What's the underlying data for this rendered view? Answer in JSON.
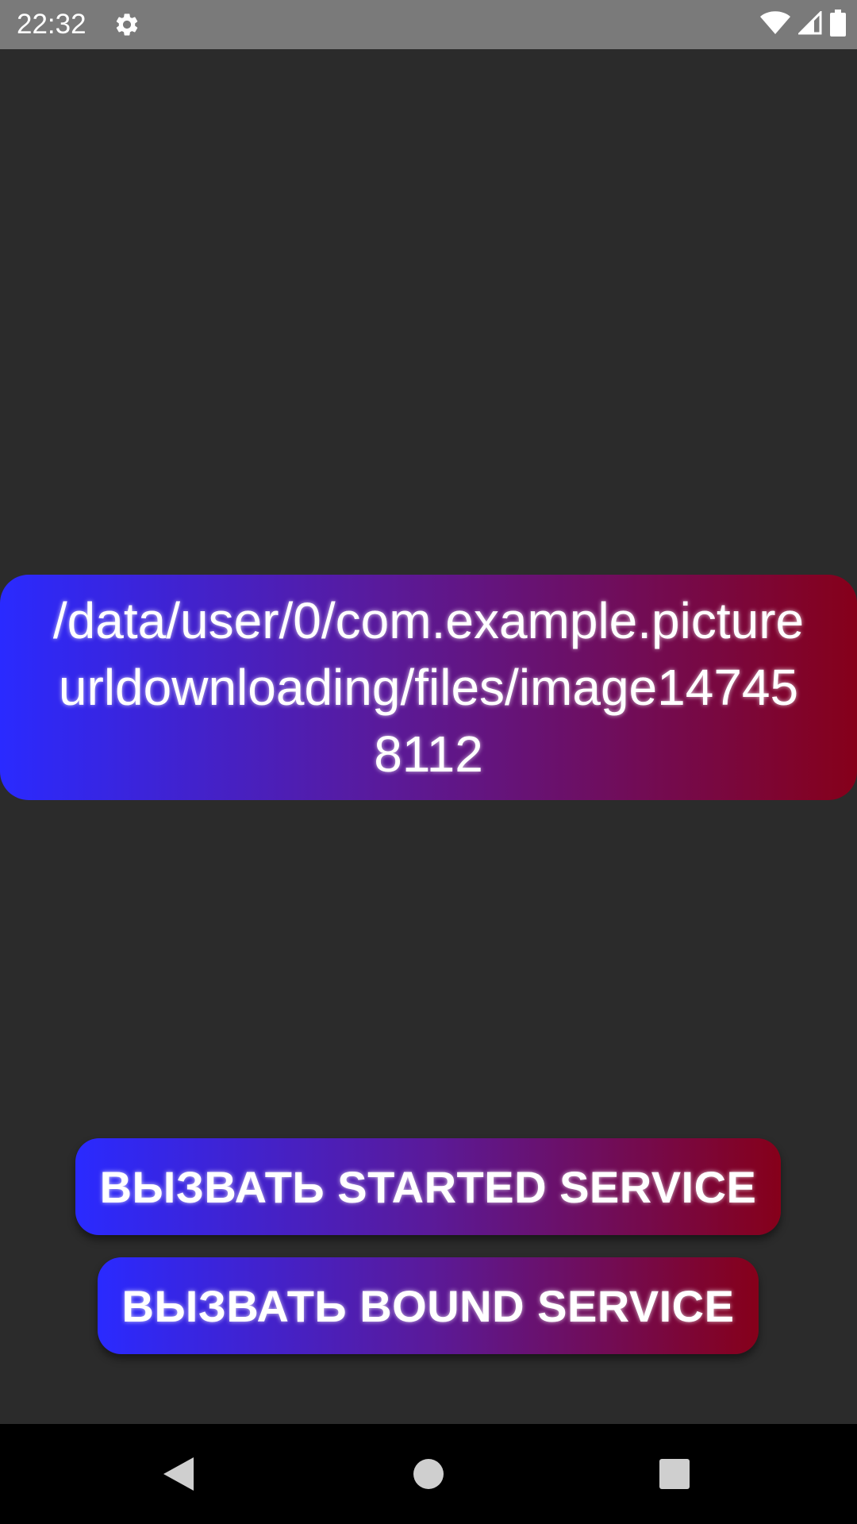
{
  "status_bar": {
    "time": "22:32",
    "icons": [
      "gear-icon",
      "wifi-icon",
      "cell-signal-icon",
      "battery-icon"
    ]
  },
  "main": {
    "file_path": "/data/user/0/com.example.pictureurldownloading/files/image147458112"
  },
  "buttons": {
    "started_service": "ВЫЗВАТЬ STARTED SERVICE",
    "bound_service": "ВЫЗВАТЬ BOUND SERVICE"
  },
  "nav_bar": {
    "icons": [
      "back-icon",
      "home-icon",
      "recents-icon"
    ]
  },
  "colors": {
    "background": "#2b2b2b",
    "gradient_start": "#2a2aff",
    "gradient_end": "#86001a",
    "status_bar": "#7a7a7a",
    "nav_bar": "#000000"
  }
}
